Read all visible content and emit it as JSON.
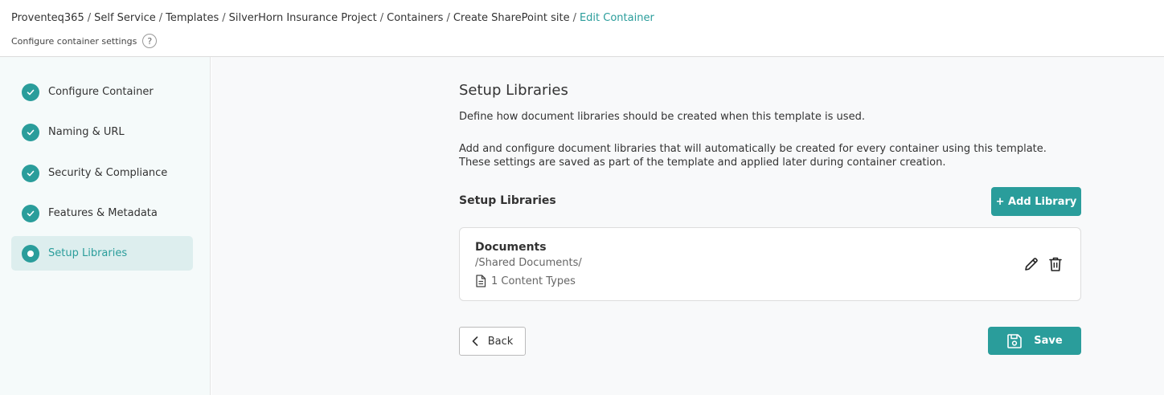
{
  "breadcrumb": [
    {
      "label": "Proventeq365"
    },
    {
      "label": "Self Service"
    },
    {
      "label": "Templates"
    },
    {
      "label": "SilverHorn Insurance Project"
    },
    {
      "label": "Containers"
    },
    {
      "label": "Create SharePoint site"
    },
    {
      "label": "Edit Container"
    }
  ],
  "breadcrumb_separator": "/",
  "page_subtitle": "Configure container settings",
  "help_label": "?",
  "steps": [
    {
      "label": "Configure Container",
      "status": "complete"
    },
    {
      "label": "Naming & URL",
      "status": "complete"
    },
    {
      "label": "Security & Compliance",
      "status": "complete"
    },
    {
      "label": "Features & Metadata",
      "status": "complete"
    },
    {
      "label": "Setup Libraries",
      "status": "current"
    }
  ],
  "main": {
    "title": "Setup Libraries",
    "description_1": "Define how document libraries should be created when this template is used.",
    "description_2": "Add and configure document libraries that will automatically be created for every container using this template. These settings are saved as part of the template and applied later during container creation.",
    "section_title": "Setup Libraries",
    "add_button": "+ Add Library",
    "libraries": [
      {
        "name": "Documents",
        "path": "/Shared Documents/",
        "content_types": "1 Content Types"
      }
    ],
    "back_button": "Back",
    "save_button": "Save"
  },
  "colors": {
    "accent": "#2a9d9b",
    "sidebar_bg": "#f5fafa",
    "active_step_bg": "#ddeeee"
  }
}
